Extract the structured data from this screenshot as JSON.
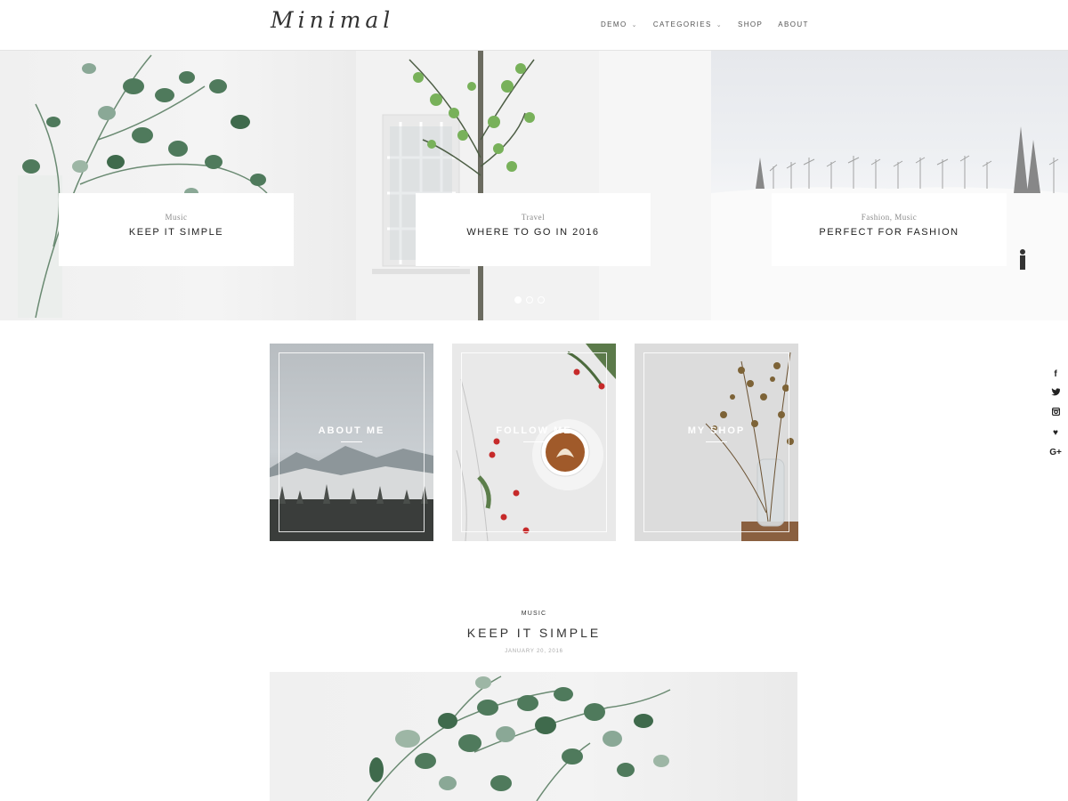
{
  "header": {
    "logo": "Minimal",
    "nav": [
      {
        "label": "DEMO",
        "has_dropdown": true
      },
      {
        "label": "CATEGORIES",
        "has_dropdown": true
      },
      {
        "label": "SHOP",
        "has_dropdown": false
      },
      {
        "label": "ABOUT",
        "has_dropdown": false
      }
    ]
  },
  "slider": {
    "slides": [
      {
        "category": "Music",
        "title": "KEEP IT SIMPLE"
      },
      {
        "category": "Travel",
        "title": "WHERE TO GO IN 2016"
      },
      {
        "category": "Fashion, Music",
        "title": "PERFECT FOR FASHION"
      }
    ],
    "active_index": 0
  },
  "promos": [
    {
      "label": "ABOUT ME"
    },
    {
      "label": "FOLLOW ME"
    },
    {
      "label": "MY SHOP"
    }
  ],
  "social": [
    {
      "icon": "facebook-icon",
      "glyph": "f"
    },
    {
      "icon": "twitter-icon",
      "glyph": "🐦"
    },
    {
      "icon": "instagram-icon",
      "glyph": "◙"
    },
    {
      "icon": "bloglovin-icon",
      "glyph": "♥"
    },
    {
      "icon": "google-plus-icon",
      "glyph": "G+"
    }
  ],
  "post": {
    "category": "MUSIC",
    "title": "KEEP IT SIMPLE",
    "date": "JANUARY 20, 2016"
  },
  "colors": {
    "accent_text": "#222222",
    "muted": "#8a8a8a",
    "leaf": "#4f7a5c"
  }
}
